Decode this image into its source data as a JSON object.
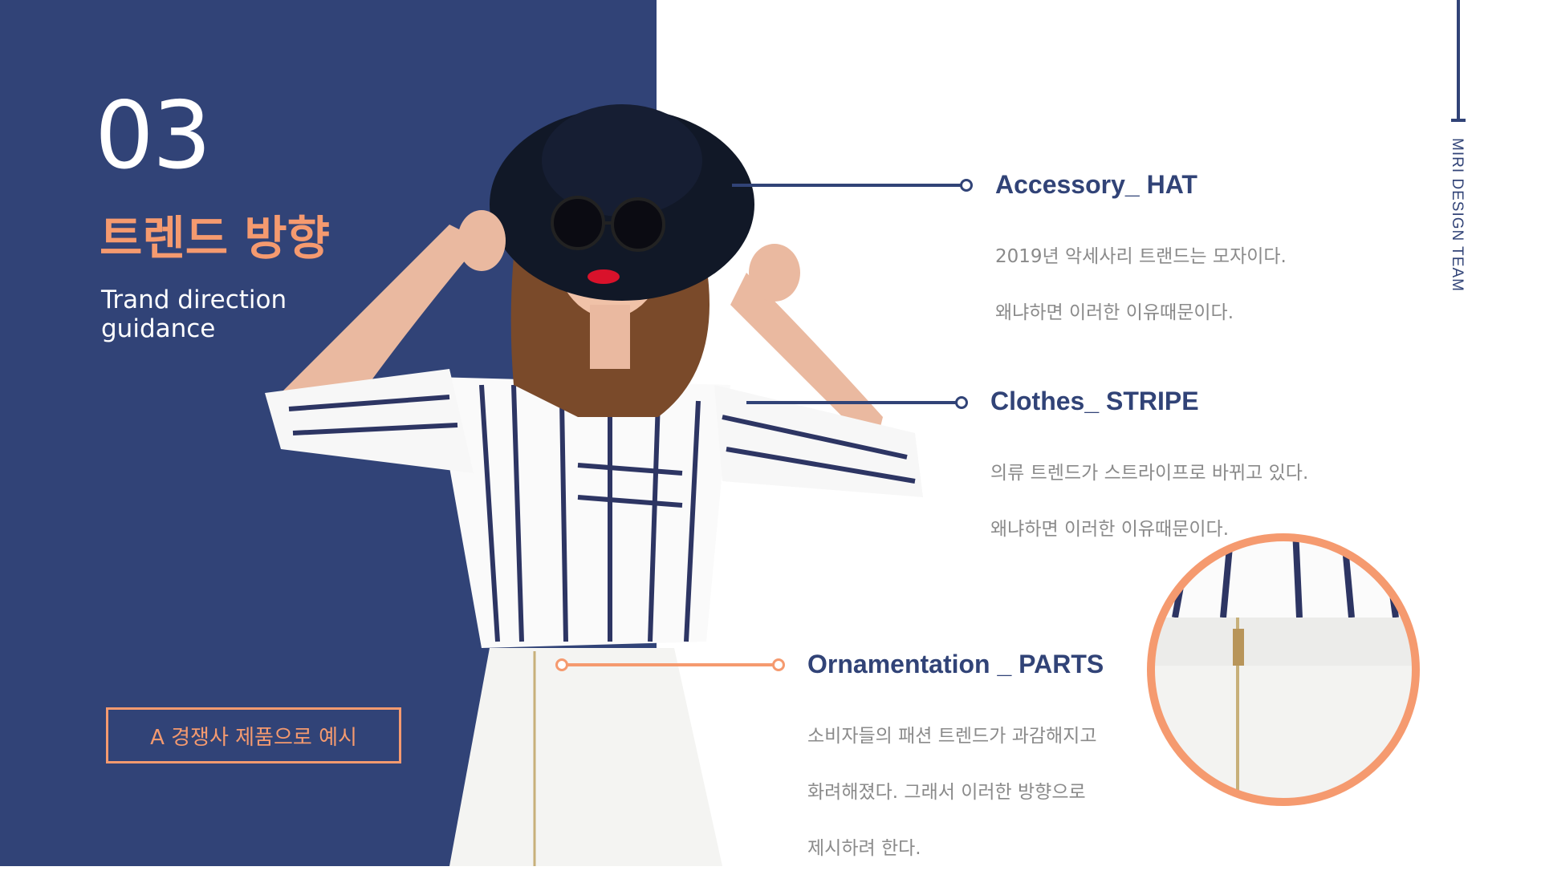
{
  "slide": {
    "number": "03",
    "title_kr": "트렌드 방향",
    "subtitle_en_lines": [
      "Trand direction",
      "guidance"
    ],
    "cta_label": "A 경쟁사 제품으로 예시",
    "team_label": "MIRI DESIGN TEAM"
  },
  "callouts": [
    {
      "title": "Accessory_ HAT",
      "desc": [
        "2019년 악세사리 트랜드는 모자이다.",
        "왜냐하면 이러한 이유때문이다."
      ]
    },
    {
      "title": "Clothes_ STRIPE",
      "desc": [
        "의류 트렌드가 스트라이프로 바뀌고 있다.",
        "왜냐하면 이러한 이유때문이다."
      ]
    },
    {
      "title": "Ornamentation _ PARTS",
      "desc": [
        "소비자들의 패션 트렌드가 과감해지고",
        "화려해졌다. 그래서 이러한 방향으로",
        "제시하려 한다."
      ]
    }
  ],
  "colors": {
    "navy": "#314377",
    "accent": "#f59a6f",
    "desc_gray": "#8a8a8a"
  },
  "icons": {
    "callout_marker": "circle-node-icon"
  }
}
